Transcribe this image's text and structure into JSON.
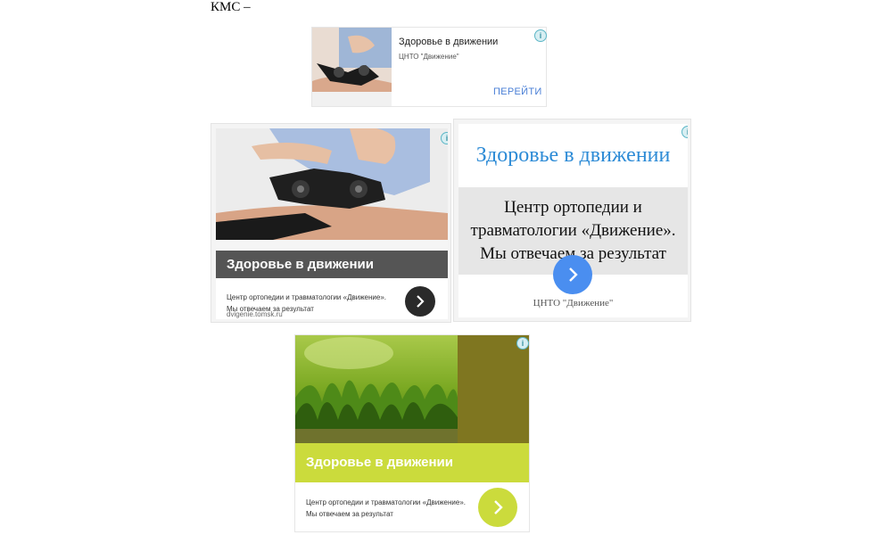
{
  "page": {
    "heading_text": "КМС –"
  },
  "ads": {
    "small": {
      "title": "Здоровье в движении",
      "subtitle": "ЦНТО \"Движение\"",
      "cta": "ПЕРЕЙТИ",
      "info_icon": "i"
    },
    "photo_card": {
      "banner": "Здоровье в движении",
      "description": "Центр ортопедии и травматологии «Движение». Мы отвечаем за результат",
      "url": "dvigenie.tomsk.ru",
      "info_icon": "i",
      "arrow": "›",
      "arrow_color": "#2a2a2a"
    },
    "text_card": {
      "headline": "Здоровье в движении",
      "body_line1": "Центр ортопедии и",
      "body_line2": "травматологии «Движение».",
      "body_line3": "Мы отвечаем за результат",
      "footer": "ЦНТО \"Движение\"",
      "info_icon": "i",
      "arrow": "›",
      "headline_color": "#2d8bd6",
      "arrow_color": "#4a8ef0"
    },
    "grass_card": {
      "banner": "Здоровье в движении",
      "description": "Центр ортопедии и травматологии «Движение». Мы отвечаем за результат",
      "info_icon": "i",
      "arrow": "›",
      "accent_color": "#cbdb3c",
      "side_color": "#7f7620"
    }
  }
}
